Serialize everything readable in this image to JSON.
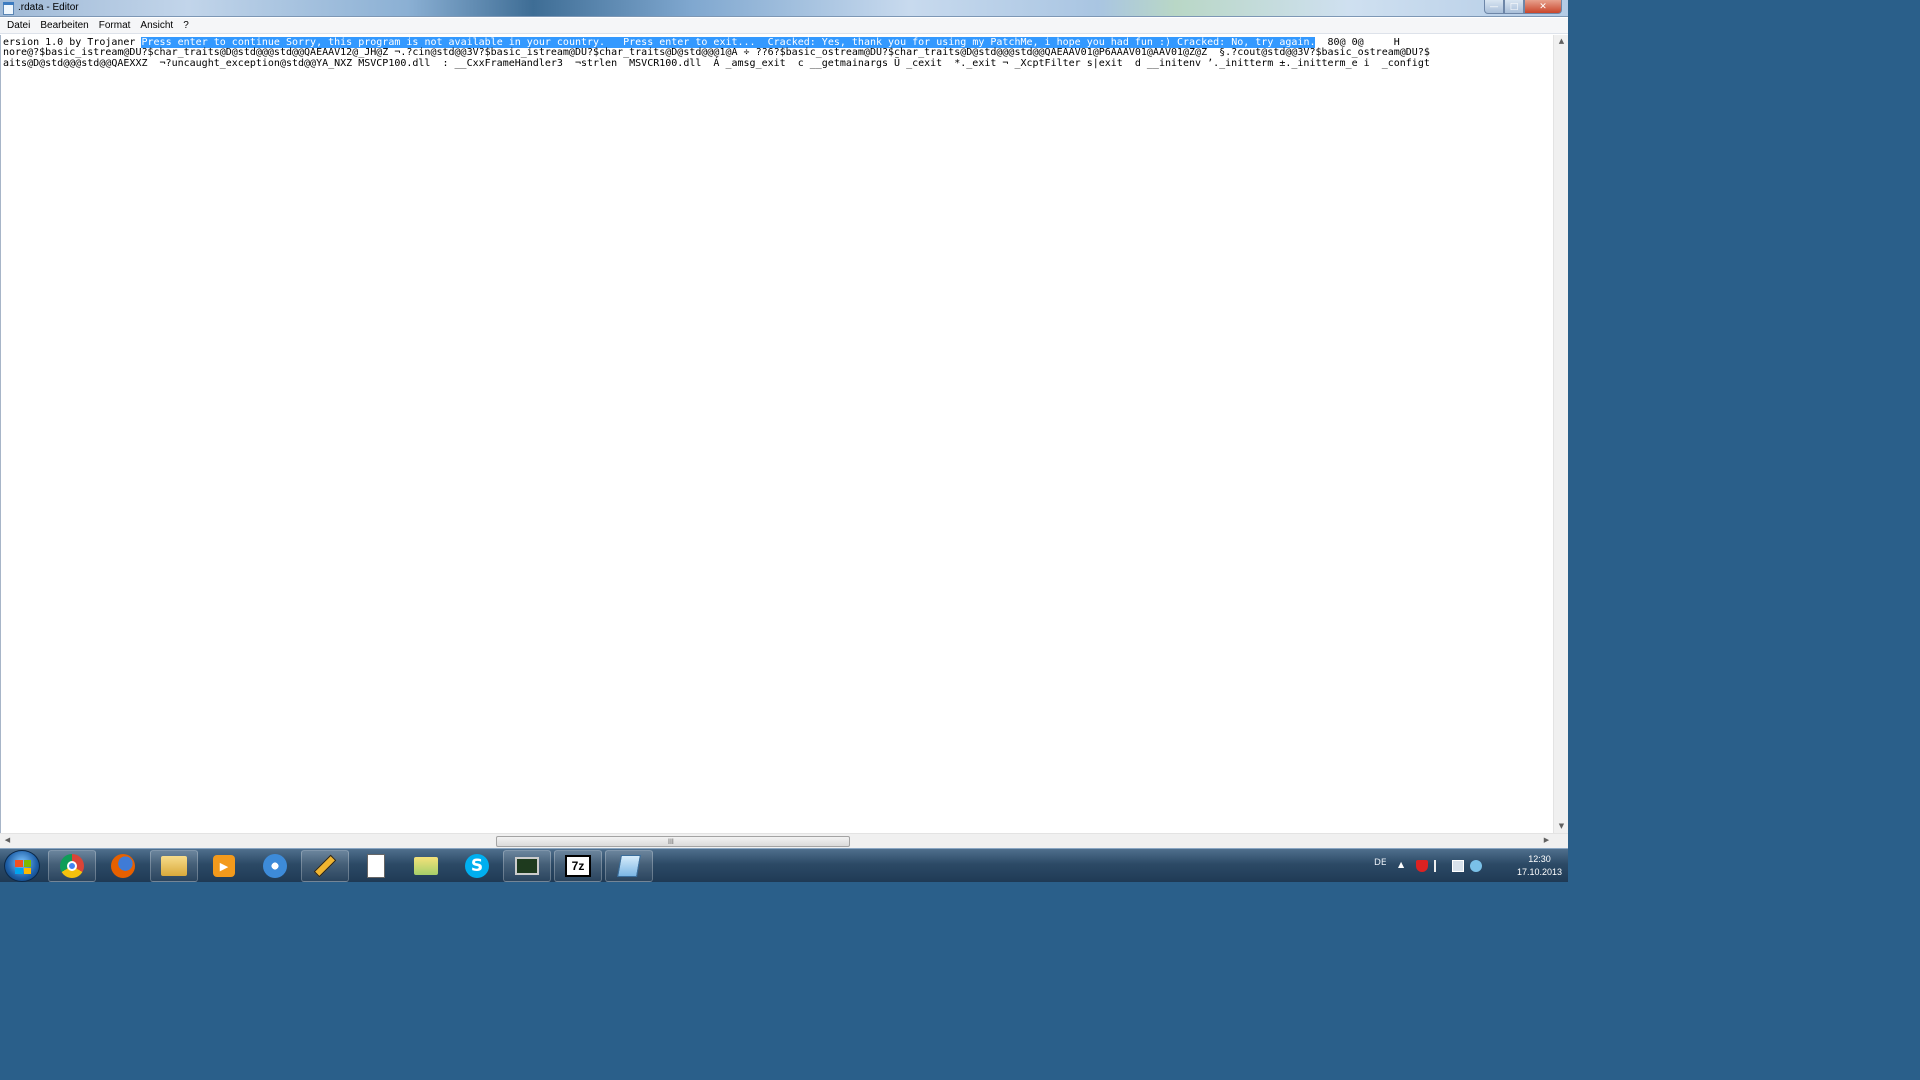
{
  "window": {
    "title": ".rdata - Editor",
    "controls": {
      "minimize": "—",
      "maximize": "□",
      "close": "✕"
    }
  },
  "menu": {
    "items": [
      "Datei",
      "Bearbeiten",
      "Format",
      "Ansicht",
      "?"
    ]
  },
  "document": {
    "line1_prefix": "ersion 1.0 by Trojaner ",
    "line1_selected": "Press enter to continue Sorry, this program is not available in your country.   Press enter to exit...  Cracked: Yes, thank you for using my PatchMe, i hope you had fun :) Cracked: No, try again.",
    "line1_suffix": "  80@ 0@     H",
    "line2": "nore@?$basic_istream@DU?$char_traits@D@std@@@std@@QAEAAV12@_JH@Z ¬.?cin@std@@3V?$basic_istream@DU?$char_traits@D@std@@@1@A ÷ ??6?$basic_ostream@DU?$char_traits@D@std@@@std@@QAEAAV01@P6AAAV01@AAV01@Z@Z  §.?cout@std@@3V?$basic_ostream@DU?$",
    "line3": "aits@D@std@@@std@@QAEXXZ  ¬?uncaught_exception@std@@YA_NXZ MSVCP100.dll  : __CxxFrameHandler3  ¬strlen  MSVCR100.dll  Á _amsg_exit  c __getmainargs Ü _cexit  *._exit ¬ _XcptFilter s|exit  d __initenv ʼ._initterm ±._initterm_e i  _configt"
  },
  "scrollbars": {
    "up": "▲",
    "down": "▼",
    "left": "◀",
    "right": "▶",
    "grip": "lll"
  },
  "taskbar": {
    "apps": [
      {
        "name": "chrome"
      },
      {
        "name": "firefox"
      },
      {
        "name": "explorer"
      },
      {
        "name": "media-player"
      },
      {
        "name": "network"
      },
      {
        "name": "pen-tool"
      },
      {
        "name": "document"
      },
      {
        "name": "folder"
      },
      {
        "name": "skype"
      },
      {
        "name": "monitor"
      },
      {
        "name": "7zip"
      },
      {
        "name": "editor"
      }
    ],
    "skype_label": "S",
    "zip_label": "7z",
    "language": "DE",
    "tray_expand": "▲",
    "clock_time": "12:30",
    "clock_date": "17.10.2013"
  }
}
